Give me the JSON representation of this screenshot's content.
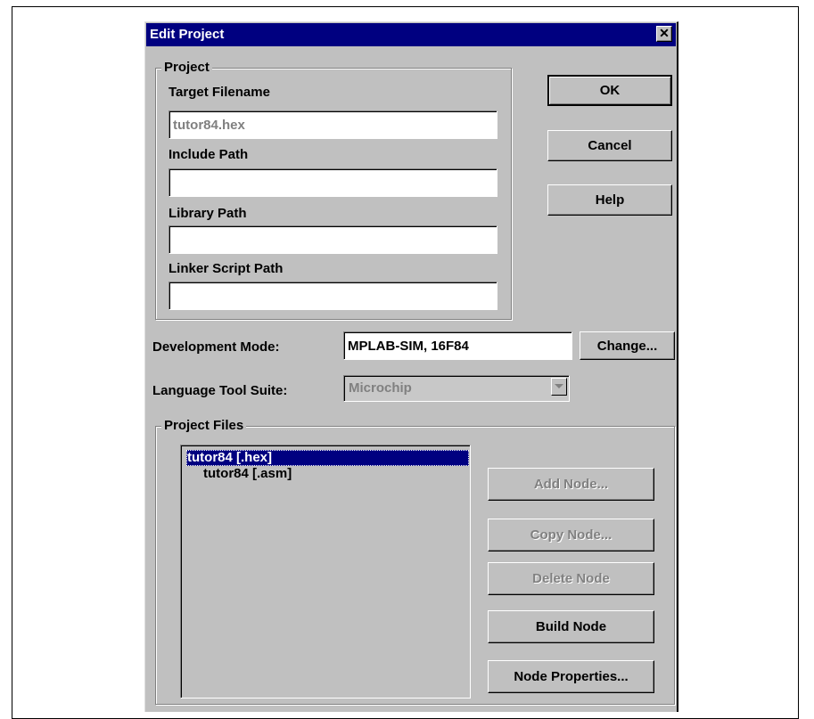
{
  "dialog": {
    "title": "Edit Project",
    "close_icon": "close-icon"
  },
  "project_group": {
    "label": "Project",
    "target_filename": {
      "label": "Target Filename",
      "value": "tutor84.hex"
    },
    "include_path": {
      "label": "Include Path",
      "value": ""
    },
    "library_path": {
      "label": "Library Path",
      "value": ""
    },
    "linker_script_path": {
      "label": "Linker Script Path",
      "value": ""
    }
  },
  "buttons": {
    "ok": "OK",
    "cancel": "Cancel",
    "help": "Help",
    "change": "Change..."
  },
  "development_mode": {
    "label": "Development Mode:",
    "value": "MPLAB-SIM, 16F84"
  },
  "language_tool_suite": {
    "label": "Language Tool Suite:",
    "selected": "Microchip",
    "dropdown_icon": "chevron-down-icon"
  },
  "project_files": {
    "label": "Project Files",
    "items": [
      {
        "text": "tutor84 [.hex]",
        "selected": true
      },
      {
        "text": "tutor84 [.asm]",
        "selected": false
      }
    ],
    "buttons": {
      "add_node": "Add Node...",
      "copy_node": "Copy Node...",
      "delete_node": "Delete Node",
      "build_node": "Build Node",
      "node_properties": "Node Properties..."
    }
  },
  "colors": {
    "titlebar": "#000080",
    "face": "#c0c0c0",
    "selection": "#000080"
  }
}
